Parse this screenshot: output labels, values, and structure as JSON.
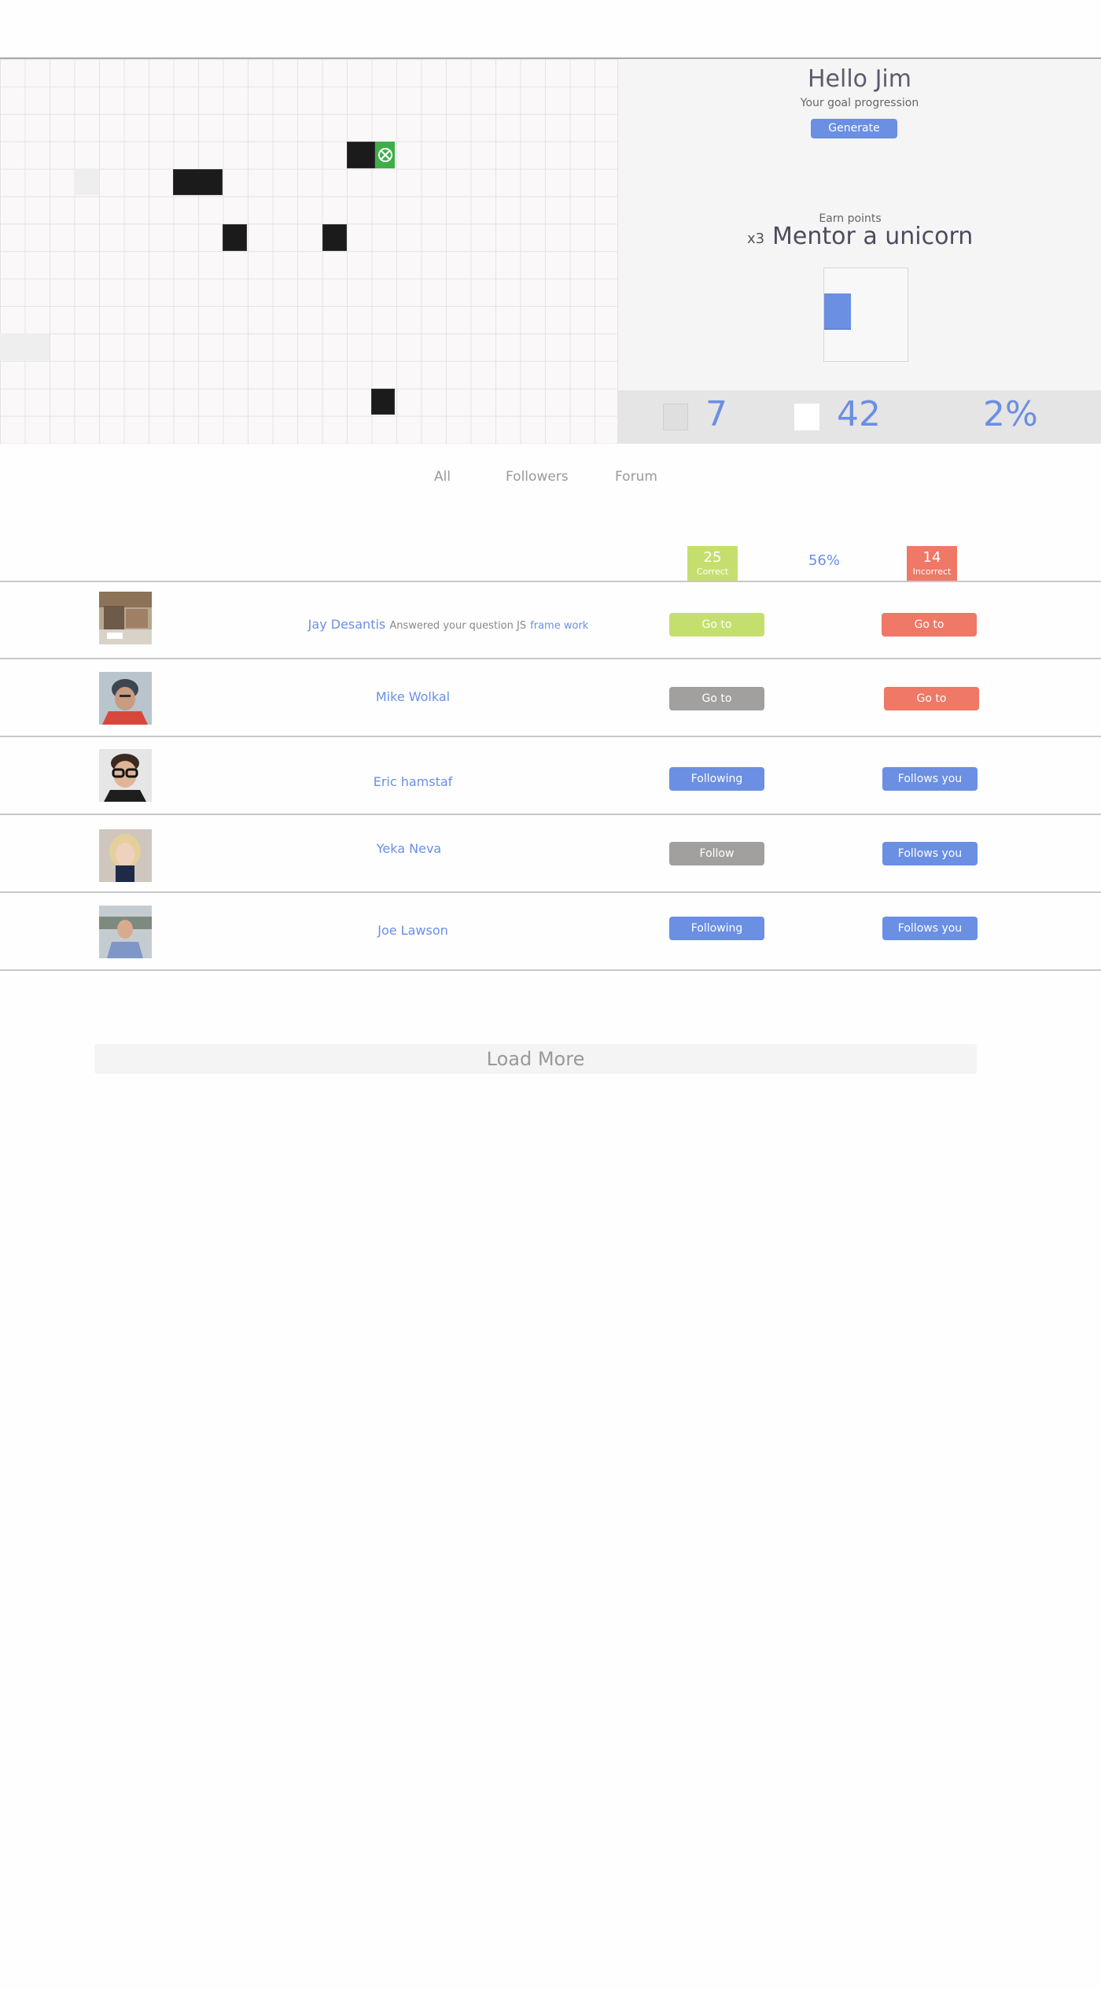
{
  "panel": {
    "greeting": "Hello Jim",
    "goal_label": "Your goal progression",
    "generate_label": "Generate",
    "earn_label": "Earn points",
    "multiplier": "x3",
    "mentor_title": "Mentor a unicorn",
    "progress_fraction": 0.52
  },
  "stats": {
    "first": "7",
    "second": "42",
    "third": "2%"
  },
  "tabs": [
    "All",
    "Followers",
    "Forum"
  ],
  "score": {
    "correct_count": "25",
    "correct_label": "Correct",
    "percent": "56%",
    "incorrect_count": "14",
    "incorrect_label": "Incorrect"
  },
  "rows": [
    {
      "name": "Jay Desantis",
      "detail": "Answered your question JS",
      "link": "frame work",
      "left_button": "Go to",
      "right_button": "Go to"
    },
    {
      "name": "Mike Wolkal",
      "left_button": "Go to",
      "right_button": "Go to"
    },
    {
      "name": "Eric hamstaf",
      "left_button": "Following",
      "right_button": "Follows you"
    },
    {
      "name": "Yeka Neva",
      "left_button": "Follow",
      "right_button": "Follows you"
    },
    {
      "name": "Joe Lawson",
      "left_button": "Following",
      "right_button": "Follows you"
    }
  ],
  "load_more": "Load More",
  "colors": {
    "accent": "#6a8fe3",
    "correct": "#c5df6e",
    "incorrect": "#ef7866",
    "neutral": "#a1a09f"
  }
}
